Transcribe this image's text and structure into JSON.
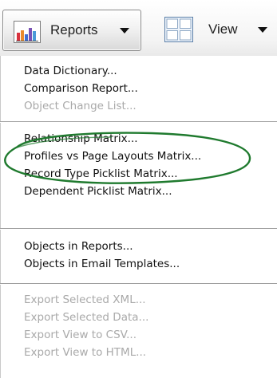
{
  "toolbar": {
    "reports": {
      "label": "Reports",
      "icon": "bar-chart-icon",
      "icon_colors": [
        "#d8333f",
        "#e98a2c",
        "#3f6fd1",
        "#7a52b5",
        "#4a9ad8"
      ]
    },
    "view": {
      "label": "View",
      "icon": "window-layout-icon"
    }
  },
  "menu": {
    "groups": [
      {
        "items": [
          {
            "label": "Data Dictionary...",
            "enabled": true
          },
          {
            "label": "Comparison Report...",
            "enabled": true
          },
          {
            "label": "Object Change List...",
            "enabled": false
          }
        ]
      },
      {
        "items": [
          {
            "label": "Relationship Matrix...",
            "enabled": true
          },
          {
            "label": "Profiles vs Page Layouts Matrix...",
            "enabled": true,
            "highlighted_by_annotation": true
          },
          {
            "label": "Record Type Picklist Matrix...",
            "enabled": true
          },
          {
            "label": "Dependent Picklist Matrix...",
            "enabled": true
          }
        ]
      },
      {
        "items": [
          {
            "label": "Objects in Reports...",
            "enabled": true
          },
          {
            "label": "Objects in Email Templates...",
            "enabled": true
          }
        ]
      },
      {
        "items": [
          {
            "label": "Export Selected XML...",
            "enabled": false
          },
          {
            "label": "Export Selected Data...",
            "enabled": false
          },
          {
            "label": "Export View to CSV...",
            "enabled": false
          },
          {
            "label": "Export View to HTML...",
            "enabled": false
          }
        ]
      }
    ]
  },
  "annotation": {
    "shape": "ellipse",
    "color": "#1f7a2e"
  }
}
